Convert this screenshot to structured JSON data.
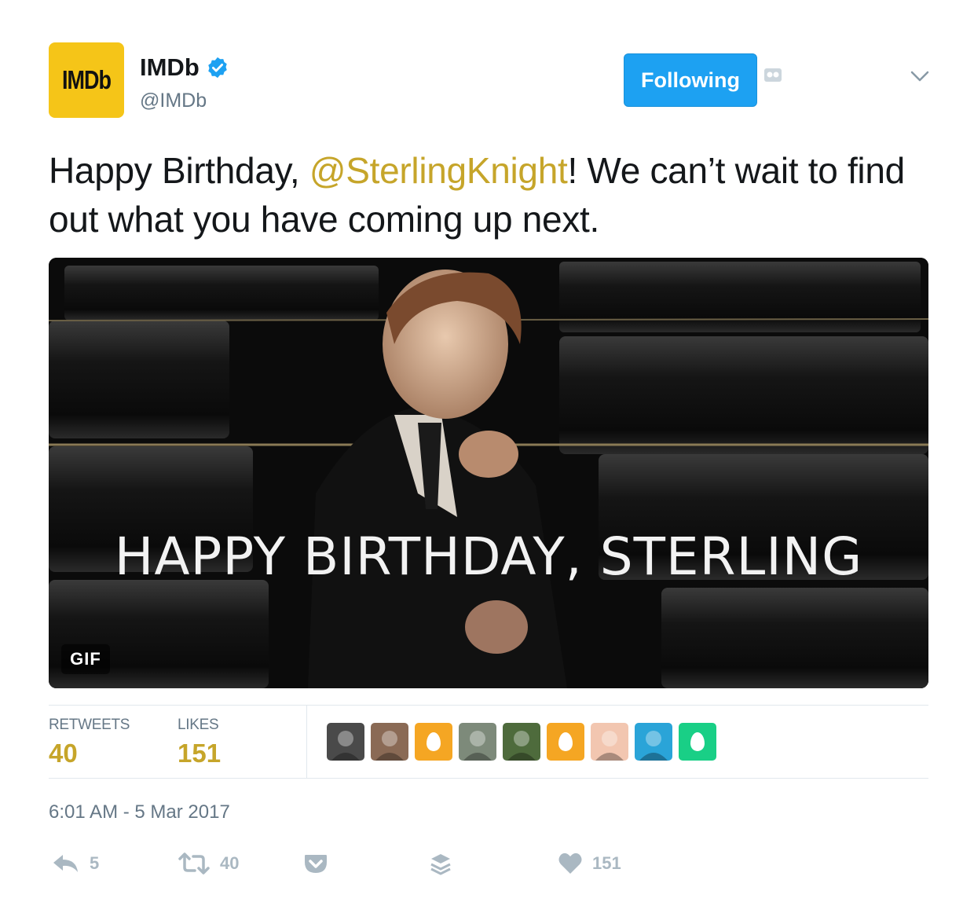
{
  "header": {
    "avatar_text": "IMDb",
    "display_name": "IMDb",
    "handle": "@IMDb",
    "follow_label": "Following"
  },
  "tweet": {
    "text_before": "Happy Birthday, ",
    "mention": "@SterlingKnight",
    "text_after": "! We can’t wait to find out what you have coming up next."
  },
  "media": {
    "overlay_text": "HAPPY BIRTHDAY, STERLING",
    "badge": "GIF"
  },
  "stats": {
    "retweets_label": "RETWEETS",
    "retweets_value": "40",
    "likes_label": "LIKES",
    "likes_value": "151"
  },
  "likers": [
    {
      "kind": "photo",
      "color": "#4a4a4a"
    },
    {
      "kind": "photo",
      "color": "#8a6a55"
    },
    {
      "kind": "egg",
      "color": "#f5a623"
    },
    {
      "kind": "photo",
      "color": "#7d8a7a"
    },
    {
      "kind": "photo",
      "color": "#4e6b3c"
    },
    {
      "kind": "egg",
      "color": "#f5a623"
    },
    {
      "kind": "photo",
      "color": "#f2c6b0"
    },
    {
      "kind": "photo",
      "color": "#2aa4d8"
    },
    {
      "kind": "egg",
      "color": "#19cf86"
    }
  ],
  "timestamp": "6:01 AM - 5 Mar 2017",
  "actions": {
    "reply_count": "5",
    "retweet_count": "40",
    "like_count": "151"
  },
  "colors": {
    "accent": "#c6a52a",
    "follow_blue": "#1da1f2",
    "imdb_yellow": "#f5c518",
    "muted": "#657786",
    "icon_gray": "#aab8c2"
  }
}
